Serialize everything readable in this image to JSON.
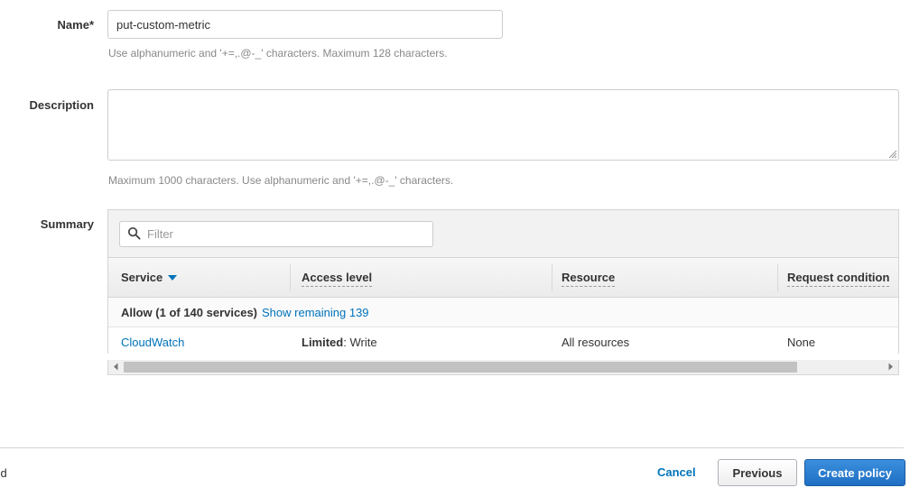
{
  "form": {
    "name": {
      "label": "Name*",
      "value": "put-custom-metric",
      "placeholder": "",
      "help": "Use alphanumeric and '+=,.@-_' characters. Maximum 128 characters."
    },
    "description": {
      "label": "Description",
      "value": "",
      "placeholder": "",
      "help": "Maximum 1000 characters. Use alphanumeric and '+=,.@-_' characters."
    },
    "summary": {
      "label": "Summary"
    }
  },
  "filter": {
    "placeholder": "Filter",
    "value": "",
    "icon": "search-icon"
  },
  "table": {
    "columns": [
      {
        "label": "Service",
        "sortable": true,
        "tooltip": false
      },
      {
        "label": "Access level",
        "sortable": false,
        "tooltip": true
      },
      {
        "label": "Resource",
        "sortable": false,
        "tooltip": true
      },
      {
        "label": "Request condition",
        "sortable": false,
        "tooltip": true
      }
    ],
    "group": {
      "effect_text": "Allow (1 of 140 services)",
      "show_remaining_link": "Show remaining 139"
    },
    "rows": [
      {
        "service": "CloudWatch",
        "access_level_strong": "Limited",
        "access_level_rest": ": Write",
        "resource": "All resources",
        "request_condition": "None"
      }
    ]
  },
  "scrollbar": {
    "left_arrow": "scroll-left-icon",
    "right_arrow": "scroll-right-icon"
  },
  "footer": {
    "required_note": "ired",
    "cancel_label": "Cancel",
    "previous_label": "Previous",
    "create_label": "Create policy"
  },
  "colors": {
    "link": "#0073bb",
    "primary_button": "#1f6fc4",
    "border": "#d5d5d5",
    "text": "#333333",
    "muted": "#888888"
  }
}
